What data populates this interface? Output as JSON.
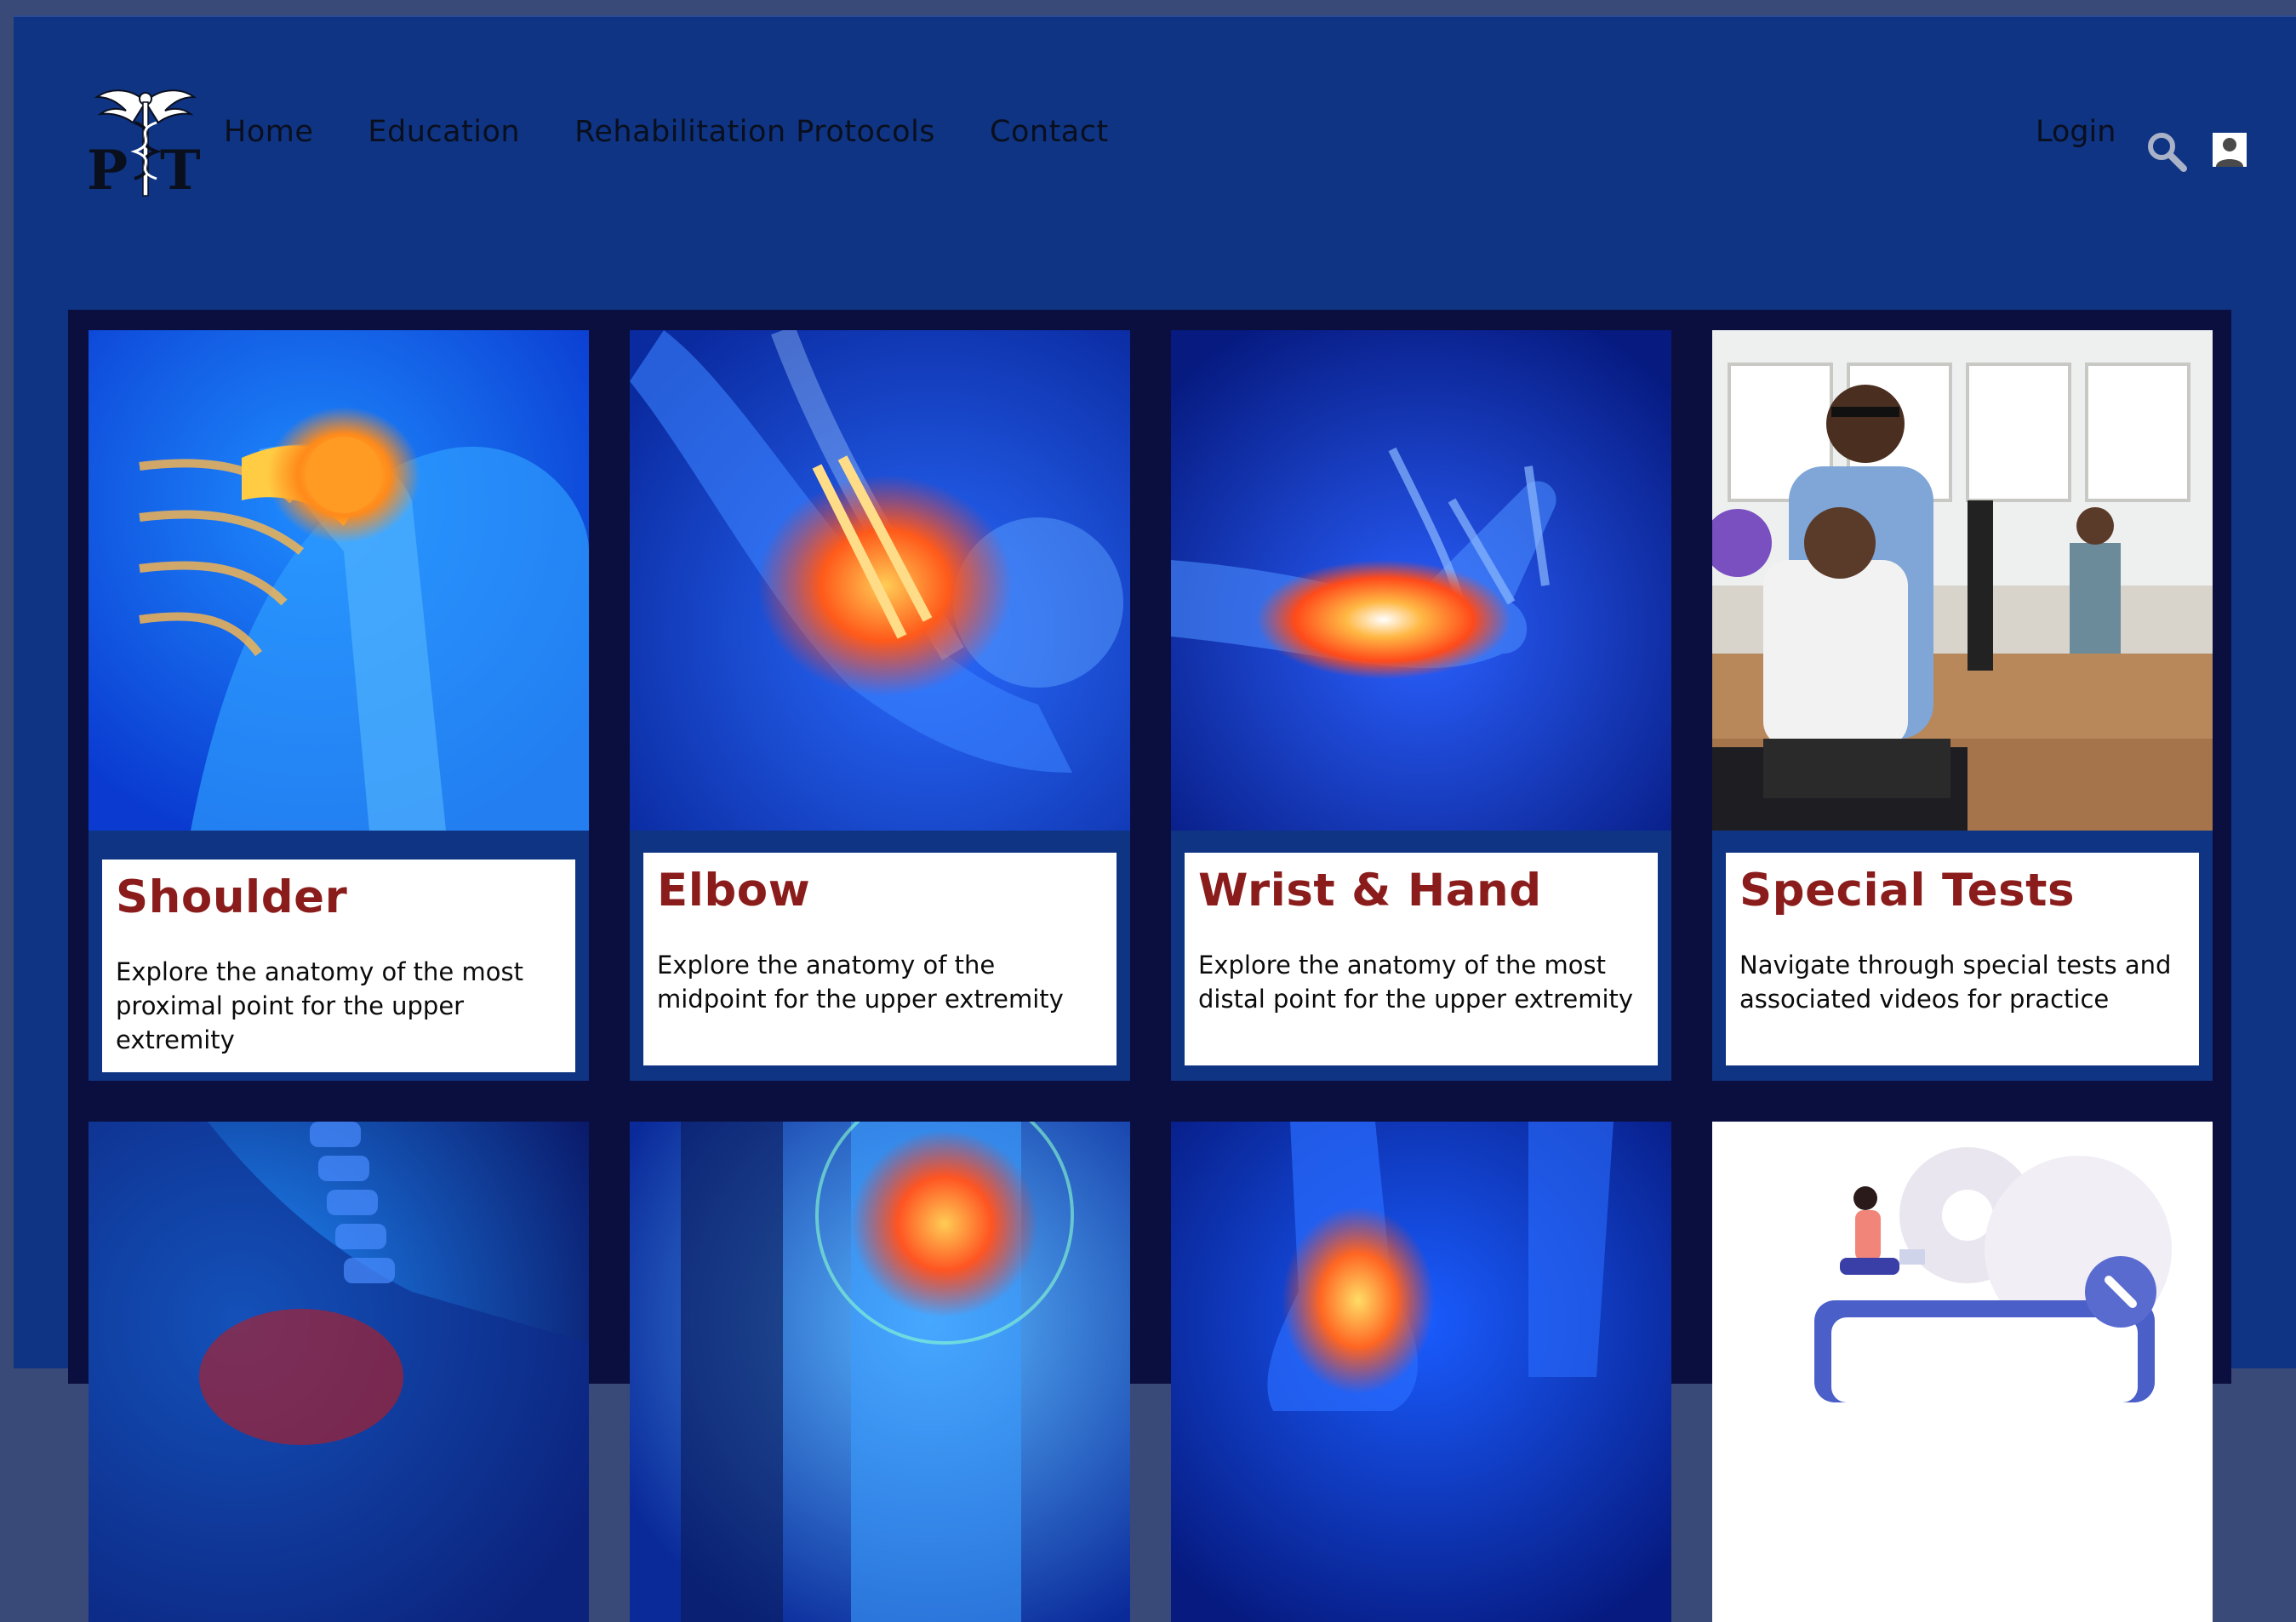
{
  "brand": {
    "logo_text": "PT",
    "logo_icon": "caduceus-icon"
  },
  "nav": {
    "items": [
      {
        "label": "Home"
      },
      {
        "label": "Education"
      },
      {
        "label": "Rehabilitation Protocols"
      },
      {
        "label": "Contact"
      }
    ]
  },
  "header_actions": {
    "login_label": "Login",
    "search_icon": "search-icon",
    "user_icon": "user-icon"
  },
  "cards": [
    {
      "title": "Shoulder",
      "description": "Explore the anatomy of the most proximal point for the upper extremity",
      "image": "shoulder-xray-image"
    },
    {
      "title": "Elbow",
      "description": "Explore the anatomy of the midpoint for the upper extremity",
      "image": "elbow-xray-image"
    },
    {
      "title": "Wrist & Hand",
      "description": "Explore the anatomy of the most distal point for the upper extremity",
      "image": "wrist-hand-xray-image"
    },
    {
      "title": "Special Tests",
      "description": "Navigate through special tests and associated videos for practice",
      "image": "therapist-photo-image"
    },
    {
      "title": "",
      "description": "",
      "image": "spine-xray-image"
    },
    {
      "title": "",
      "description": "",
      "image": "knee-xray-image"
    },
    {
      "title": "",
      "description": "",
      "image": "ankle-xray-image"
    },
    {
      "title": "",
      "description": "",
      "image": "tools-illustration-image"
    }
  ],
  "colors": {
    "page_background": "#0f3483",
    "panel_background": "#0a0f3f",
    "card_title": "#8b1c1c",
    "card_body": "#ffffff"
  }
}
